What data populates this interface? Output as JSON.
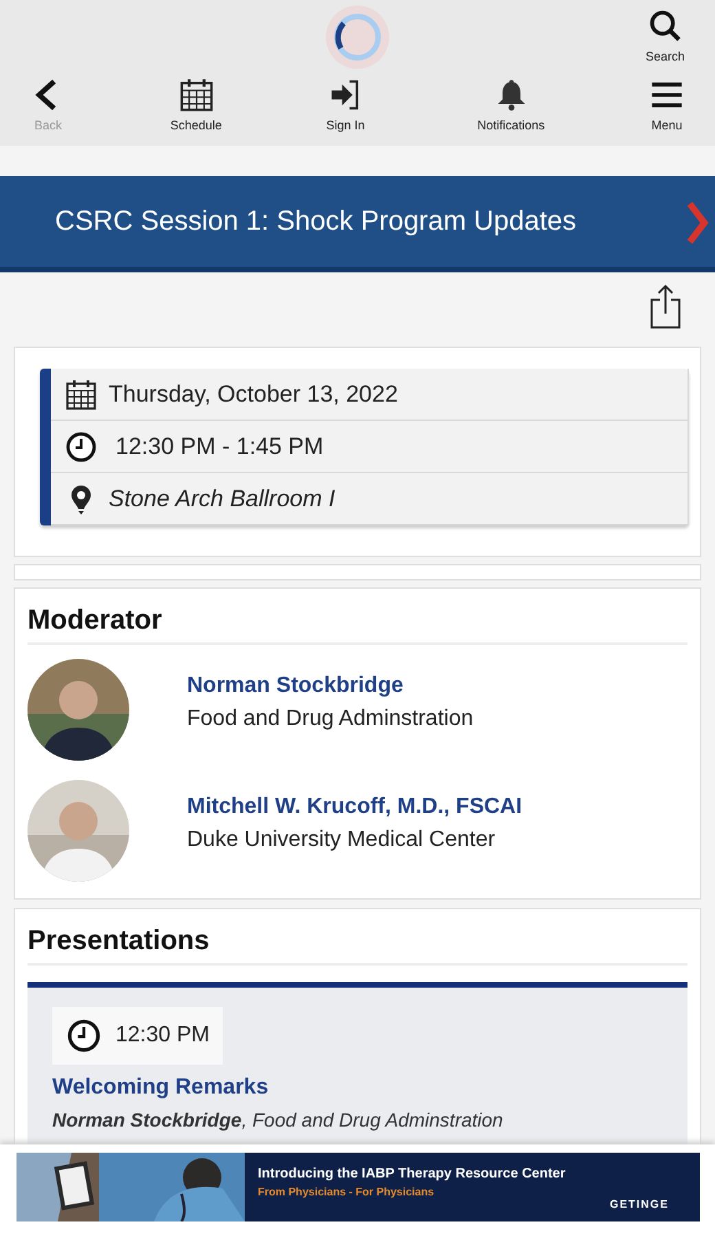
{
  "search": {
    "label": "Search"
  },
  "nav": [
    {
      "kind": "back",
      "label": "Back",
      "disabled": true
    },
    {
      "kind": "calendar",
      "label": "Schedule",
      "disabled": false
    },
    {
      "kind": "signin",
      "label": "Sign In",
      "disabled": false
    },
    {
      "kind": "bell",
      "label": "Notifications",
      "disabled": false
    },
    {
      "kind": "menu",
      "label": "Menu",
      "disabled": false
    }
  ],
  "session": {
    "title": "CSRC Session 1: Shock Program Updates"
  },
  "details": [
    {
      "kind": "calendar",
      "text": "Thursday, October 13, 2022"
    },
    {
      "kind": "clock",
      "text": "12:30 PM - 1:45 PM"
    },
    {
      "kind": "pin",
      "text": "Stone Arch Ballroom I"
    }
  ],
  "moderators": {
    "heading": "Moderator",
    "people": [
      {
        "name": "Norman Stockbridge",
        "affiliation": "Food and Drug Adminstration"
      },
      {
        "name": "Mitchell W. Krucoff, M.D., FSCAI",
        "affiliation": "Duke University Medical Center"
      }
    ]
  },
  "presentations": {
    "heading": "Presentations",
    "items": [
      {
        "time": "12:30 PM",
        "title": "Welcoming Remarks",
        "speaker": "**Norman Stockbridge**, Food and Drug Adminstration"
      }
    ]
  },
  "ad": {
    "headline": "Introducing the IABP Therapy Resource Center",
    "tagline": "From Physicians - For Physicians",
    "brand": "GETINGE"
  }
}
